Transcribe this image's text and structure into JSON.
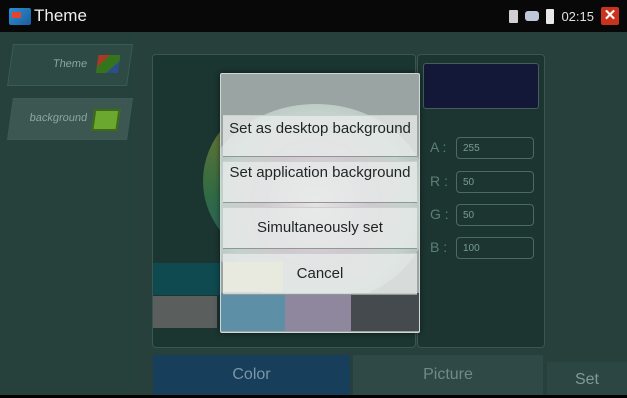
{
  "window": {
    "title": "Theme",
    "time": "02:15"
  },
  "sidebar": {
    "items": [
      {
        "label": "Theme"
      },
      {
        "label": "background"
      }
    ]
  },
  "color_panel": {
    "preview_color": "#141838",
    "channels": [
      {
        "label": "A :",
        "value": "255"
      },
      {
        "label": "R :",
        "value": "50"
      },
      {
        "label": "G :",
        "value": "50"
      },
      {
        "label": "B :",
        "value": "100"
      }
    ]
  },
  "tabs": [
    {
      "label": "Color"
    },
    {
      "label": "Picture"
    }
  ],
  "set_label": "Set",
  "dialog": {
    "options": [
      {
        "label": "Set as desktop background"
      },
      {
        "label": "Set application background"
      },
      {
        "label": "Simultaneously set"
      },
      {
        "label": "Cancel"
      }
    ]
  }
}
